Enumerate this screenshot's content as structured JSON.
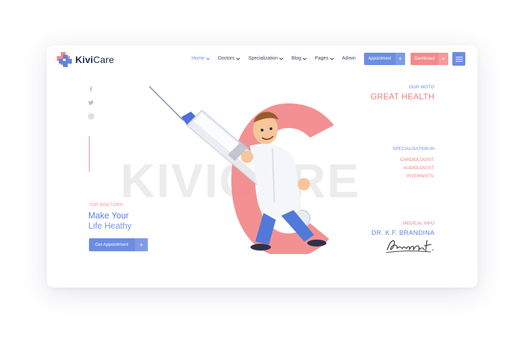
{
  "brand": {
    "name_part1": "Kivi",
    "name_part2": "Care",
    "colors": {
      "primary": "#6b8de3",
      "accent": "#f28b8c",
      "dark": "#1f2b4d"
    }
  },
  "nav": {
    "items": [
      {
        "label": "Home",
        "dropdown": true,
        "active": true
      },
      {
        "label": "Doctors",
        "dropdown": true
      },
      {
        "label": "Specialization",
        "dropdown": true
      },
      {
        "label": "Blog",
        "dropdown": true
      },
      {
        "label": "Pages",
        "dropdown": true
      },
      {
        "label": "Admin",
        "dropdown": false
      }
    ],
    "appointment_label": "Appointment",
    "dashboard_label": "Dashboard",
    "plus": "+"
  },
  "social": {
    "icons": [
      "facebook-icon",
      "twitter-icon",
      "instagram-icon"
    ]
  },
  "hero": {
    "background_word": "KIVICARE",
    "top_label": "TOP DOCTORS",
    "headline_line1": "Make Your",
    "headline_line2": "Life Heathy",
    "cta_label": "Get Appointment",
    "cta_plus": "+"
  },
  "moto": {
    "label": "OUR MOTO",
    "title": "GREAT HEALTH"
  },
  "specialisation": {
    "label": "SPECIALISATION IN",
    "items": [
      "CARDIOLOGIST:",
      "AUDIOLOGIST:",
      "INTERNISTS:"
    ]
  },
  "medical": {
    "label": "MEDICAL INFO",
    "name": "DR. K.F. BRANDINA",
    "signature": "Brandon F."
  }
}
